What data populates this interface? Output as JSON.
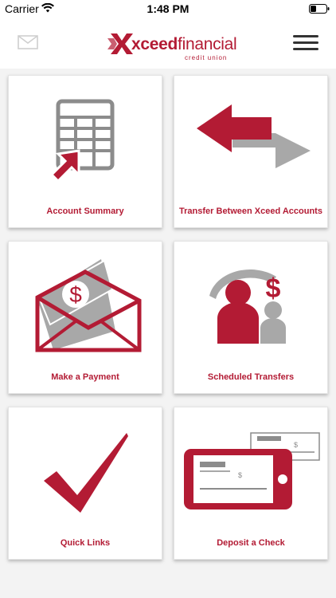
{
  "status_bar": {
    "carrier": "Carrier",
    "time": "1:48 PM"
  },
  "header": {
    "logo_text_bold": "xceed",
    "logo_text_light": "financial",
    "logo_subtitle": "credit union"
  },
  "tiles": [
    {
      "label": "Account Summary",
      "icon": "spreadsheet-arrow-icon"
    },
    {
      "label": "Transfer Between Xceed Accounts",
      "icon": "transfer-arrows-icon"
    },
    {
      "label": "Make a Payment",
      "icon": "envelope-payment-icon"
    },
    {
      "label": "Scheduled Transfers",
      "icon": "scheduled-transfer-people-icon"
    },
    {
      "label": "Quick Links",
      "icon": "checkmark-icon"
    },
    {
      "label": "Deposit a Check",
      "icon": "phone-check-deposit-icon"
    }
  ],
  "colors": {
    "brand": "#b31b34",
    "gray": "#8c8c8c",
    "light_gray": "#a8a8a8"
  }
}
